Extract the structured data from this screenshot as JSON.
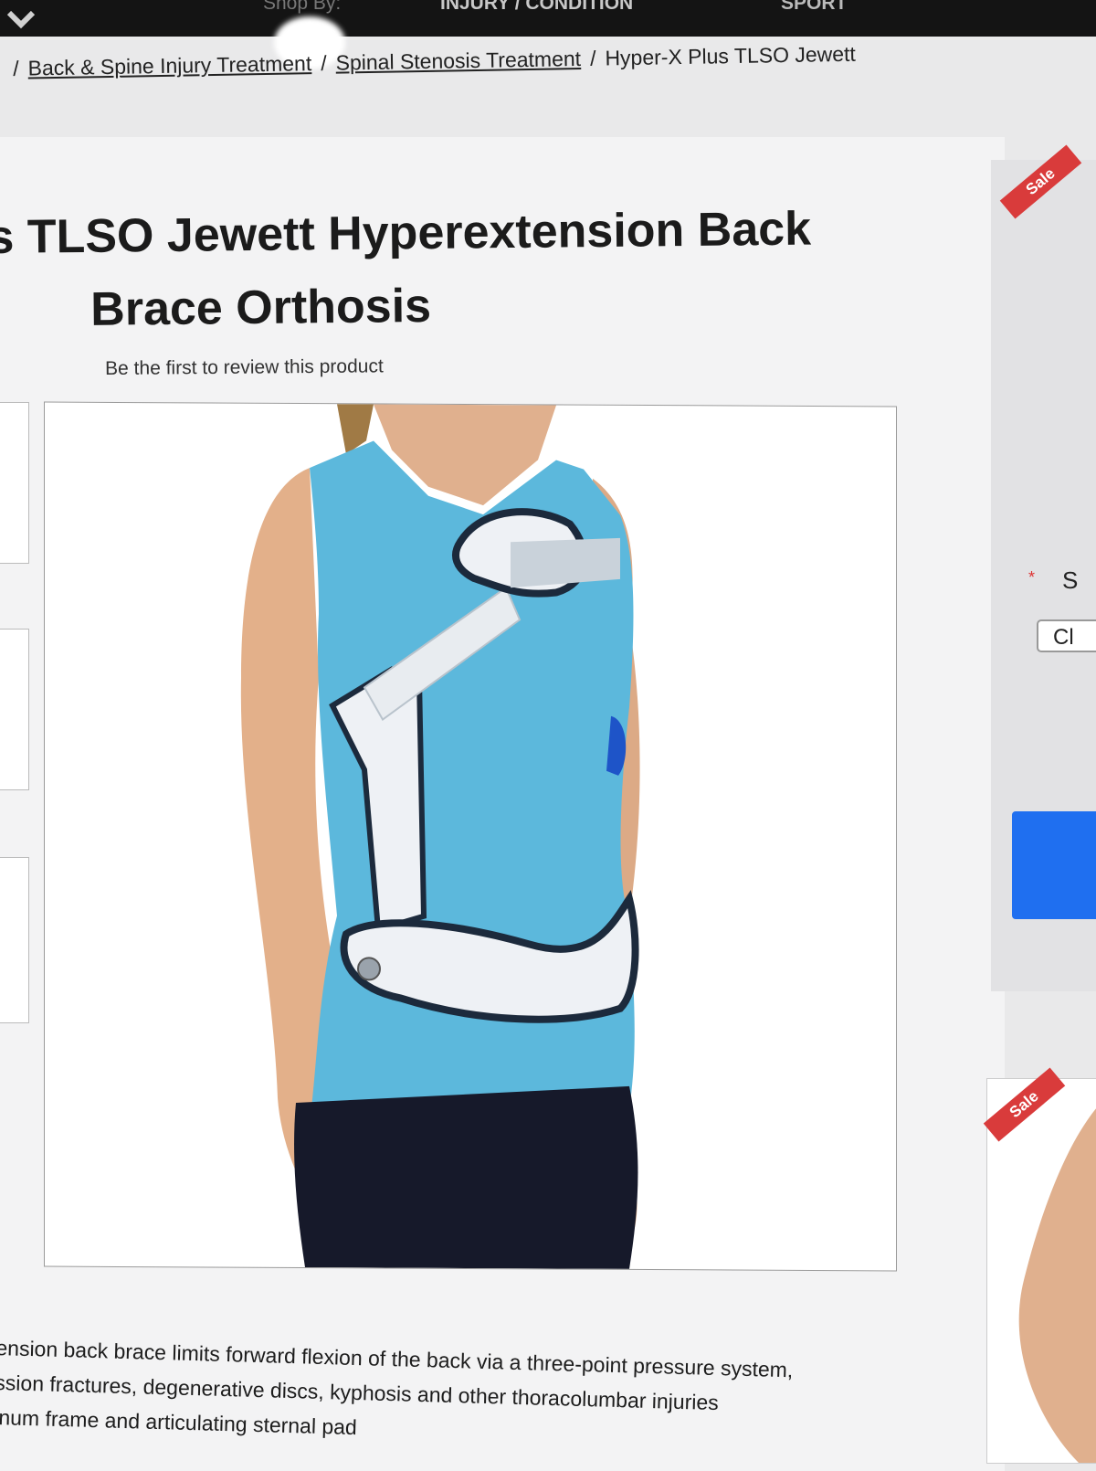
{
  "nav": {
    "shop_by": "Shop By:",
    "injury": "INJURY / CONDITION",
    "sport": "SPORT"
  },
  "breadcrumb": {
    "items": [
      "Back & Spine Injury Treatment",
      "Spinal Stenosis Treatment"
    ],
    "current": "Hyper-X Plus TLSO Jewett"
  },
  "product": {
    "title_line1": "s TLSO Jewett Hyperextension Back",
    "title_line2": "Brace Orthosis",
    "review_link": "Be the first to review this product",
    "description": [
      "ension back brace limits forward flexion of the back via a three-point pressure system,",
      "ssion fractures, degenerative discs, kyphosis and other thoracolumbar injuries",
      "inum frame and articulating sternal pad"
    ]
  },
  "sidebar": {
    "sale_badge": "Sale",
    "partial_label": "S",
    "partial_button": "Cl",
    "colors": {
      "sale": "#d93b3b",
      "cart_button": "#1f6ff0"
    }
  },
  "related": {
    "sale_badge": "Sale"
  }
}
